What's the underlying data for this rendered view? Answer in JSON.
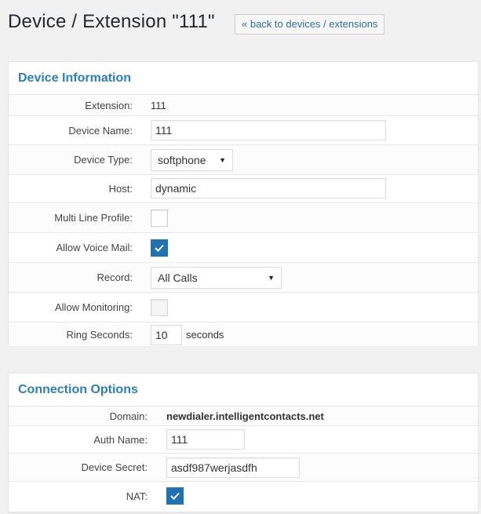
{
  "header": {
    "title": "Device / Extension \"111\"",
    "back_label": "« back to devices / extensions"
  },
  "device_info": {
    "title": "Device Information",
    "extension": {
      "label": "Extension:",
      "value": "111"
    },
    "device_name": {
      "label": "Device Name:",
      "value": "111"
    },
    "device_type": {
      "label": "Device Type:",
      "selected": "softphone"
    },
    "host": {
      "label": "Host:",
      "value": "dynamic"
    },
    "multi_line": {
      "label": "Multi Line Profile:",
      "checked": false
    },
    "voice_mail": {
      "label": "Allow Voice Mail:",
      "checked": true
    },
    "record": {
      "label": "Record:",
      "selected": "All Calls"
    },
    "monitoring": {
      "label": "Allow Monitoring:",
      "checked": false
    },
    "ring_seconds": {
      "label": "Ring Seconds:",
      "value": "10",
      "unit": "seconds"
    }
  },
  "connection": {
    "title": "Connection Options",
    "domain": {
      "label": "Domain:",
      "value": "newdialer.intelligentcontacts.net"
    },
    "auth_name": {
      "label": "Auth Name:",
      "value": "111"
    },
    "device_secret": {
      "label": "Device Secret:",
      "value": "asdf987werjasdfh"
    },
    "nat": {
      "label": "NAT:",
      "checked": true
    }
  },
  "colors": {
    "accent": "#2271b1",
    "panel_title": "#2f7fb7",
    "link": "#2e6da4"
  }
}
